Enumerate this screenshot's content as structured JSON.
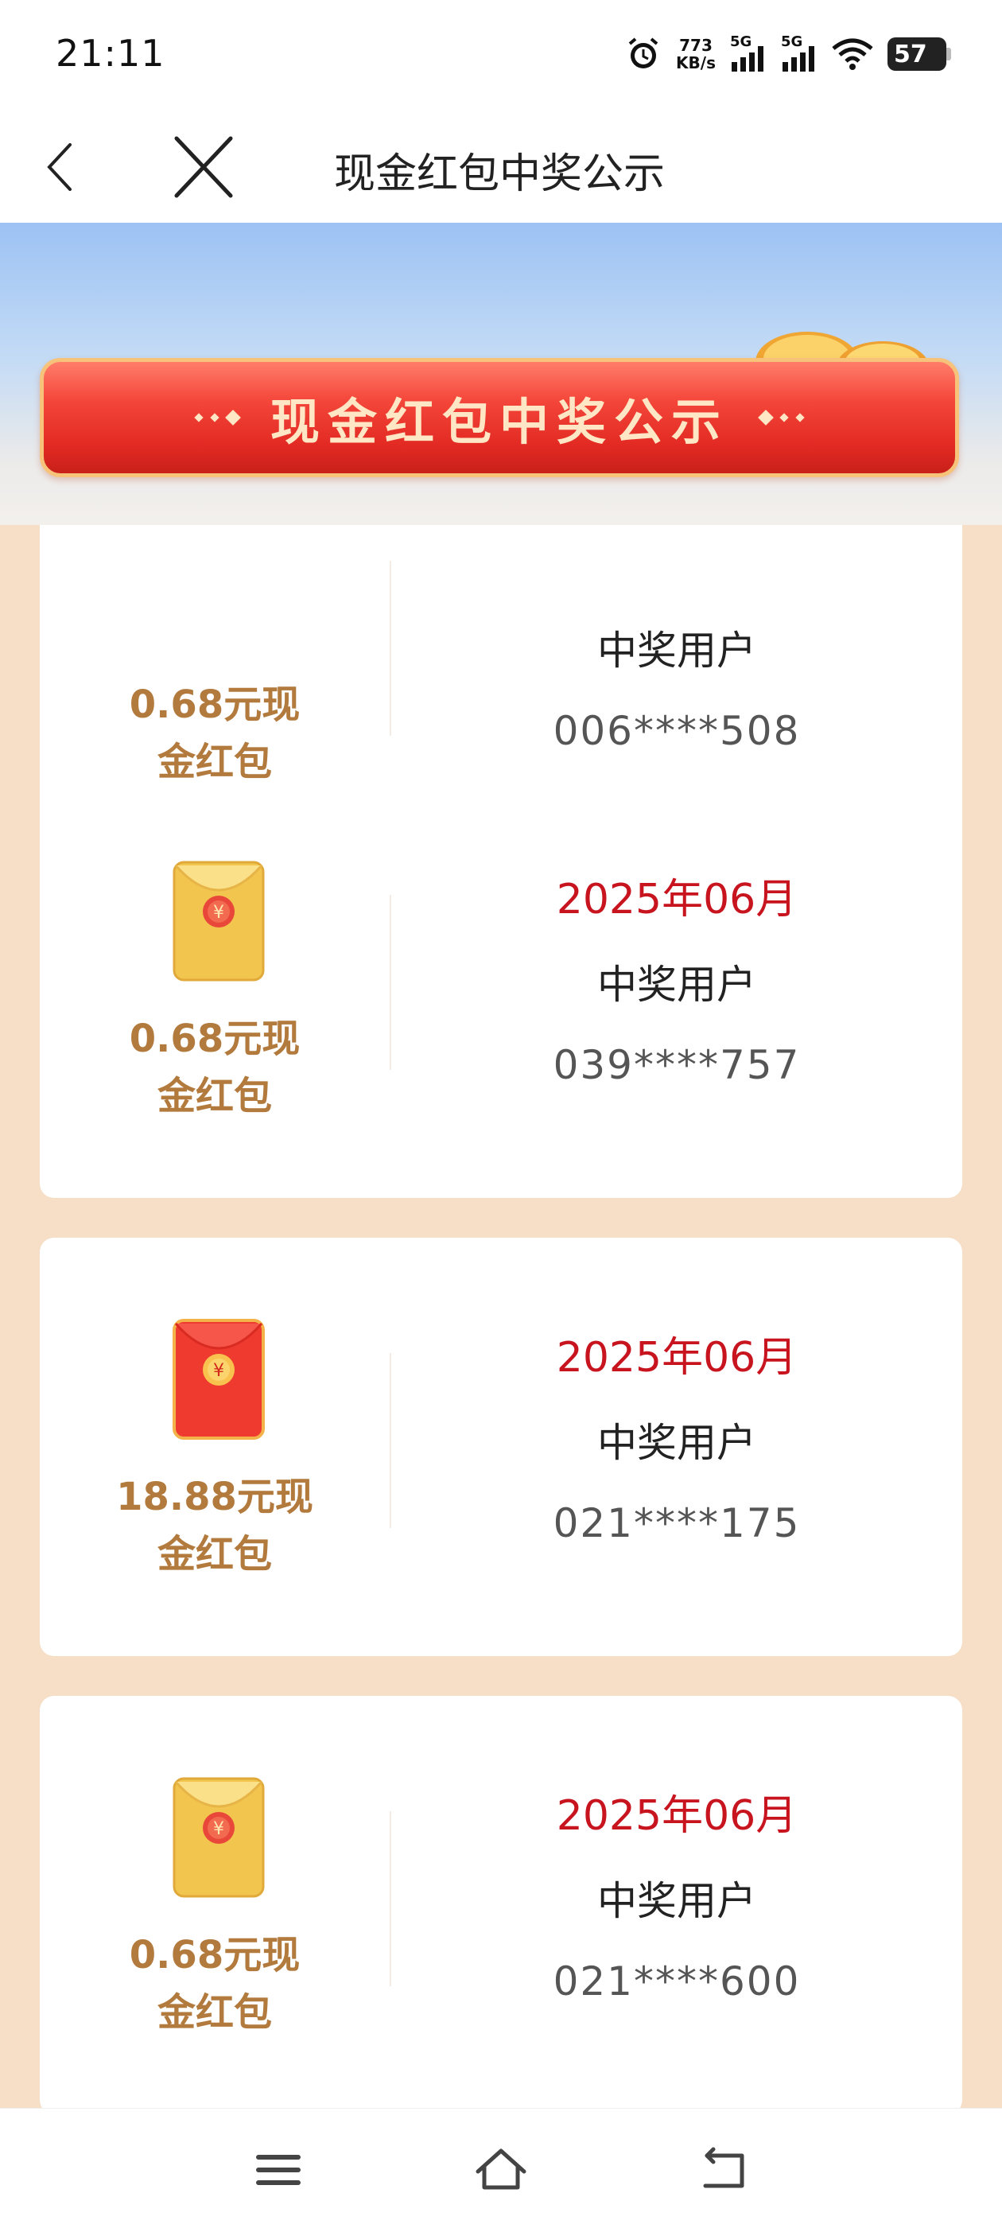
{
  "status_bar": {
    "time": "21:11",
    "speed_value": "773",
    "speed_unit": "KB/s",
    "signal1": "5G",
    "signal2": "5G",
    "battery": "57"
  },
  "nav": {
    "title": "现金红包中奖公示"
  },
  "banner": {
    "title": "现金红包中奖公示"
  },
  "records": [
    {
      "prize_line1": "0.68元现",
      "prize_line2": "金红包",
      "envelope": "gold",
      "date": "",
      "user_label": "中奖用户",
      "phone": "006****508"
    },
    {
      "prize_line1": "0.68元现",
      "prize_line2": "金红包",
      "envelope": "gold",
      "date": "2025年06月",
      "user_label": "中奖用户",
      "phone": "039****757"
    },
    {
      "prize_line1": "18.88元现",
      "prize_line2": "金红包",
      "envelope": "red",
      "date": "2025年06月",
      "user_label": "中奖用户",
      "phone": "021****175"
    },
    {
      "prize_line1": "0.68元现",
      "prize_line2": "金红包",
      "envelope": "gold",
      "date": "2025年06月",
      "user_label": "中奖用户",
      "phone": "021****600"
    }
  ],
  "colors": {
    "date": "#c8141e",
    "prize": "#b27a3d",
    "page_bg": "#f6dfc6",
    "banner_red": "#e22a23"
  },
  "icons": [
    "back-icon",
    "close-icon",
    "menu-icon",
    "home-icon",
    "return-icon",
    "alarm-icon",
    "wifi-icon",
    "coins-icon",
    "red-envelope-icon"
  ]
}
